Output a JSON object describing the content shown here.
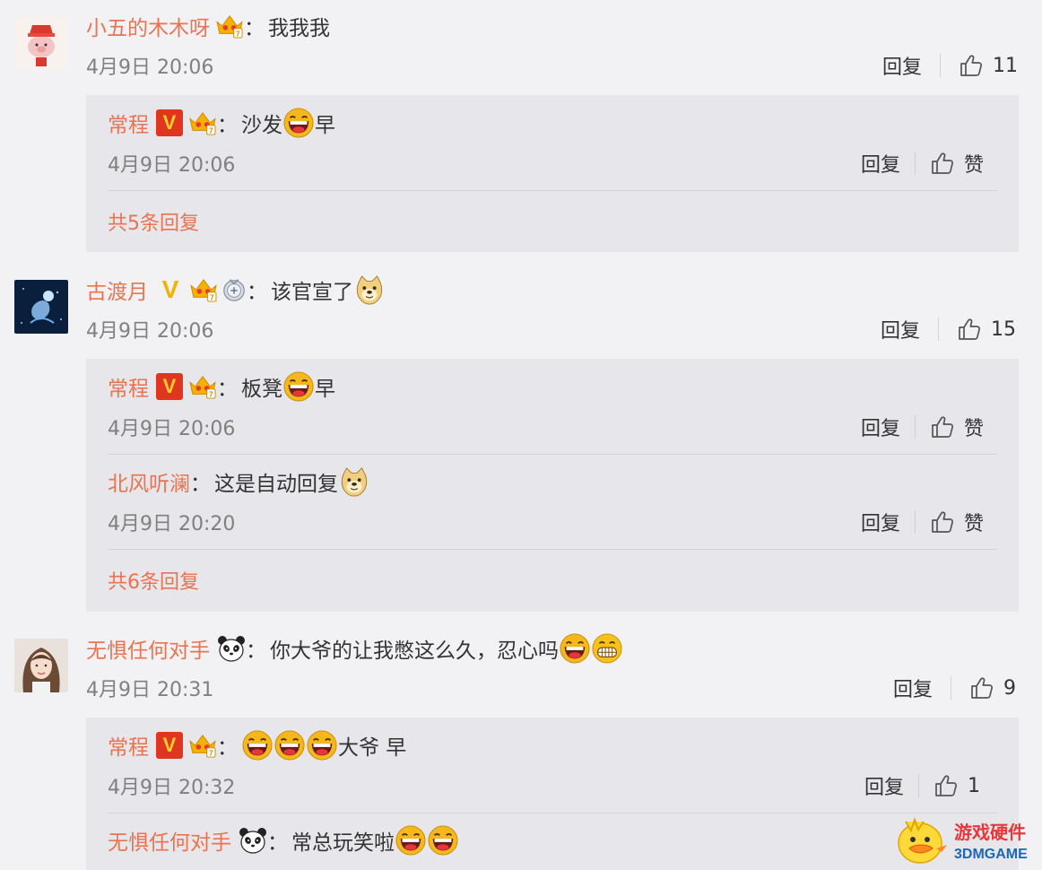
{
  "comments": [
    {
      "username": "小五的木木呀",
      "text": "我我我",
      "time": "4月9日 20:06",
      "reply_label": "回复",
      "like_count": "11",
      "replies": [
        {
          "username": "常程",
          "text_before": "沙发",
          "text_after": "早",
          "time": "4月9日 20:06",
          "reply_label": "回复",
          "like_label": "赞"
        }
      ],
      "more_label": "共5条回复"
    },
    {
      "username": "古渡月",
      "text": "该官宣了",
      "time": "4月9日 20:06",
      "reply_label": "回复",
      "like_count": "15",
      "replies": [
        {
          "username": "常程",
          "text_before": "板凳",
          "text_after": "早",
          "time": "4月9日 20:06",
          "reply_label": "回复",
          "like_label": "赞"
        },
        {
          "username": "北风听澜",
          "text_before": "这是自动回复",
          "time": "4月9日 20:20",
          "reply_label": "回复",
          "like_label": "赞"
        }
      ],
      "more_label": "共6条回复"
    },
    {
      "username": "无惧任何对手",
      "text": "你大爷的让我憋这么久，忍心吗",
      "time": "4月9日 20:31",
      "reply_label": "回复",
      "like_count": "9",
      "replies": [
        {
          "username": "常程",
          "text_after": "大爷 早",
          "time": "4月9日 20:32",
          "reply_label": "回复",
          "like_count": "1"
        },
        {
          "username": "无惧任何对手",
          "text_before": "常总玩笑啦"
        }
      ]
    }
  ],
  "colon": "：",
  "badge_v": "V",
  "watermark": {
    "line1": "游戏硬件",
    "line2": "3DMGAME"
  },
  "colors": {
    "username": "#eb7350",
    "background": "#f2f2f5",
    "reply_box": "#e6e6eb",
    "time": "#808080"
  },
  "icons": [
    "crown-icon",
    "verified-v-icon",
    "laugh-emoji-icon",
    "doge-emoji-icon",
    "grin-emoji-icon",
    "panda-icon",
    "medal-icon",
    "thumb-up-icon"
  ]
}
